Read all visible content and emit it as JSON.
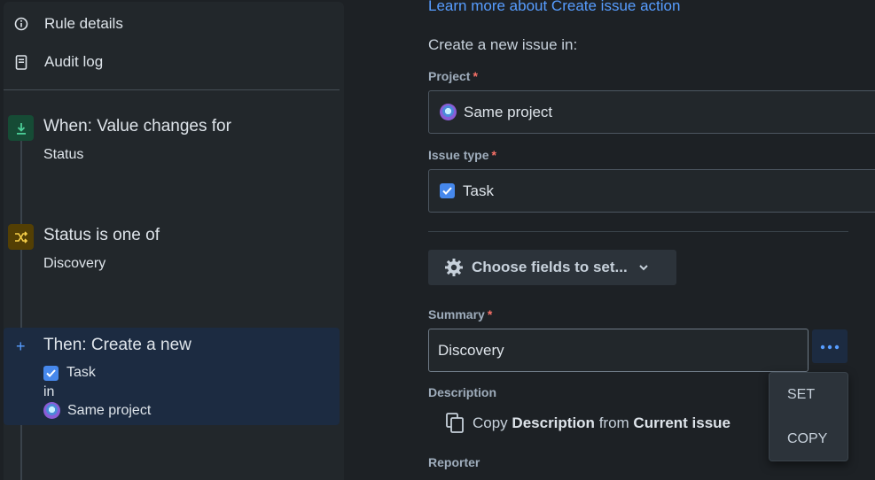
{
  "sidebar": {
    "nav": [
      {
        "label": "Rule details",
        "icon": "info-icon"
      },
      {
        "label": "Audit log",
        "icon": "document-icon"
      }
    ],
    "trigger": {
      "title": "When: Value changes for",
      "subtitle": "Status",
      "icon": "trigger-icon",
      "color": "#1f845a"
    },
    "condition": {
      "title": "Status is one of",
      "subtitle": "Discovery",
      "icon": "branch-icon",
      "color": "#e2b203"
    },
    "action": {
      "title": "Then: Create a new",
      "issue_type": "Task",
      "connector": "in",
      "project": "Same project",
      "icon": "plus-icon"
    }
  },
  "main": {
    "learn_more": "Learn more about Create issue action",
    "intro": "Create a new issue in:",
    "project": {
      "label": "Project",
      "required_mark": "*",
      "value": "Same project"
    },
    "issue_type": {
      "label": "Issue type",
      "required_mark": "*",
      "value": "Task"
    },
    "choose_fields": "Choose fields to set...",
    "summary": {
      "label": "Summary",
      "required_mark": "*",
      "value": "Discovery"
    },
    "description": {
      "label": "Description",
      "copy_prefix": "Copy",
      "copy_field": "Description",
      "copy_middle": "from",
      "copy_source": "Current issue"
    },
    "reporter": {
      "label": "Reporter"
    },
    "menu": {
      "items": [
        "SET",
        "COPY"
      ]
    }
  },
  "colors": {
    "accent": "#579dff",
    "required": "#f87168",
    "task": "#4688ec"
  }
}
